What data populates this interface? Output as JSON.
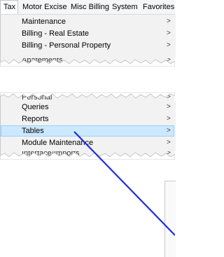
{
  "menubar": {
    "items": [
      {
        "label": "Tax"
      },
      {
        "label": "Motor Excise"
      },
      {
        "label": "Misc Billing"
      },
      {
        "label": "System"
      },
      {
        "label": "Favorites"
      }
    ]
  },
  "top_menu": {
    "items": [
      {
        "label": "Maintenance",
        "chevron": ">"
      },
      {
        "label": "Billing - Real Estate",
        "chevron": ">"
      },
      {
        "label": "Billing - Personal Property",
        "chevron": ">"
      },
      {
        "label": "Abatements",
        "chevron": ">"
      }
    ]
  },
  "bottom_menu": {
    "items": [
      {
        "label": "Personal",
        "chevron": ">"
      },
      {
        "label": "Queries",
        "chevron": ">"
      },
      {
        "label": "Reports",
        "chevron": ">"
      },
      {
        "label": "Tables",
        "chevron": ">"
      },
      {
        "label": "Module Maintenance",
        "chevron": ">"
      },
      {
        "label": "Interface/Imports",
        "chevron": ">"
      }
    ]
  },
  "colors": {
    "highlight_bg": "#cce8ff",
    "highlight_border": "#99d1ff",
    "pointer_line": "#1f2fd6"
  }
}
